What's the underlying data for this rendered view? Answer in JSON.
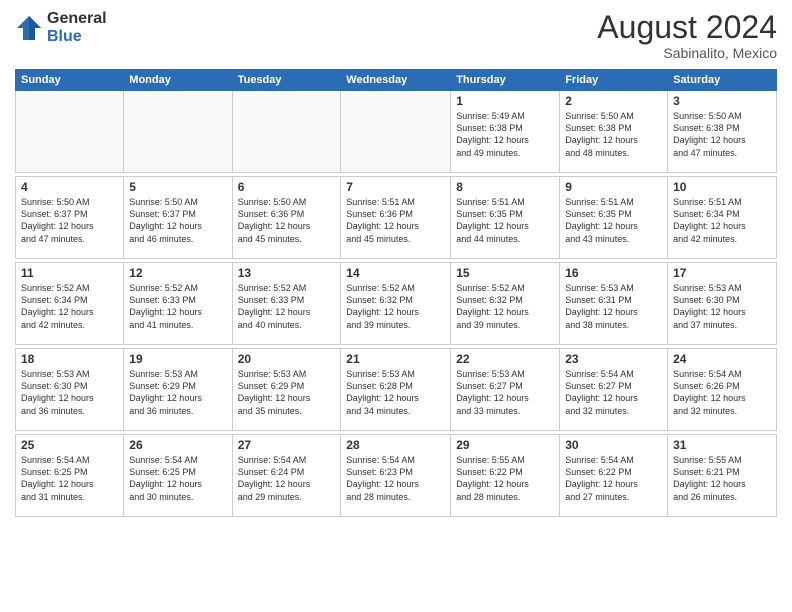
{
  "header": {
    "logo_general": "General",
    "logo_blue": "Blue",
    "main_title": "August 2024",
    "subtitle": "Sabinalito, Mexico"
  },
  "days_of_week": [
    "Sunday",
    "Monday",
    "Tuesday",
    "Wednesday",
    "Thursday",
    "Friday",
    "Saturday"
  ],
  "weeks": [
    {
      "cells": [
        {
          "empty": true
        },
        {
          "empty": true
        },
        {
          "empty": true
        },
        {
          "empty": true
        },
        {
          "day": 1,
          "sunrise": "5:49 AM",
          "sunset": "6:38 PM",
          "daylight_hours": "12 hours",
          "daylight_minutes": "49 minutes"
        },
        {
          "day": 2,
          "sunrise": "5:50 AM",
          "sunset": "6:38 PM",
          "daylight_hours": "12 hours",
          "daylight_minutes": "48 minutes"
        },
        {
          "day": 3,
          "sunrise": "5:50 AM",
          "sunset": "6:38 PM",
          "daylight_hours": "12 hours",
          "daylight_minutes": "47 minutes"
        }
      ]
    },
    {
      "cells": [
        {
          "day": 4,
          "sunrise": "5:50 AM",
          "sunset": "6:37 PM",
          "daylight_hours": "12 hours",
          "daylight_minutes": "47 minutes"
        },
        {
          "day": 5,
          "sunrise": "5:50 AM",
          "sunset": "6:37 PM",
          "daylight_hours": "12 hours",
          "daylight_minutes": "46 minutes"
        },
        {
          "day": 6,
          "sunrise": "5:50 AM",
          "sunset": "6:36 PM",
          "daylight_hours": "12 hours",
          "daylight_minutes": "45 minutes"
        },
        {
          "day": 7,
          "sunrise": "5:51 AM",
          "sunset": "6:36 PM",
          "daylight_hours": "12 hours",
          "daylight_minutes": "45 minutes"
        },
        {
          "day": 8,
          "sunrise": "5:51 AM",
          "sunset": "6:35 PM",
          "daylight_hours": "12 hours",
          "daylight_minutes": "44 minutes"
        },
        {
          "day": 9,
          "sunrise": "5:51 AM",
          "sunset": "6:35 PM",
          "daylight_hours": "12 hours",
          "daylight_minutes": "43 minutes"
        },
        {
          "day": 10,
          "sunrise": "5:51 AM",
          "sunset": "6:34 PM",
          "daylight_hours": "12 hours",
          "daylight_minutes": "42 minutes"
        }
      ]
    },
    {
      "cells": [
        {
          "day": 11,
          "sunrise": "5:52 AM",
          "sunset": "6:34 PM",
          "daylight_hours": "12 hours",
          "daylight_minutes": "42 minutes"
        },
        {
          "day": 12,
          "sunrise": "5:52 AM",
          "sunset": "6:33 PM",
          "daylight_hours": "12 hours",
          "daylight_minutes": "41 minutes"
        },
        {
          "day": 13,
          "sunrise": "5:52 AM",
          "sunset": "6:33 PM",
          "daylight_hours": "12 hours",
          "daylight_minutes": "40 minutes"
        },
        {
          "day": 14,
          "sunrise": "5:52 AM",
          "sunset": "6:32 PM",
          "daylight_hours": "12 hours",
          "daylight_minutes": "39 minutes"
        },
        {
          "day": 15,
          "sunrise": "5:52 AM",
          "sunset": "6:32 PM",
          "daylight_hours": "12 hours",
          "daylight_minutes": "39 minutes"
        },
        {
          "day": 16,
          "sunrise": "5:53 AM",
          "sunset": "6:31 PM",
          "daylight_hours": "12 hours",
          "daylight_minutes": "38 minutes"
        },
        {
          "day": 17,
          "sunrise": "5:53 AM",
          "sunset": "6:30 PM",
          "daylight_hours": "12 hours",
          "daylight_minutes": "37 minutes"
        }
      ]
    },
    {
      "cells": [
        {
          "day": 18,
          "sunrise": "5:53 AM",
          "sunset": "6:30 PM",
          "daylight_hours": "12 hours",
          "daylight_minutes": "36 minutes"
        },
        {
          "day": 19,
          "sunrise": "5:53 AM",
          "sunset": "6:29 PM",
          "daylight_hours": "12 hours",
          "daylight_minutes": "36 minutes"
        },
        {
          "day": 20,
          "sunrise": "5:53 AM",
          "sunset": "6:29 PM",
          "daylight_hours": "12 hours",
          "daylight_minutes": "35 minutes"
        },
        {
          "day": 21,
          "sunrise": "5:53 AM",
          "sunset": "6:28 PM",
          "daylight_hours": "12 hours",
          "daylight_minutes": "34 minutes"
        },
        {
          "day": 22,
          "sunrise": "5:53 AM",
          "sunset": "6:27 PM",
          "daylight_hours": "12 hours",
          "daylight_minutes": "33 minutes"
        },
        {
          "day": 23,
          "sunrise": "5:54 AM",
          "sunset": "6:27 PM",
          "daylight_hours": "12 hours",
          "daylight_minutes": "32 minutes"
        },
        {
          "day": 24,
          "sunrise": "5:54 AM",
          "sunset": "6:26 PM",
          "daylight_hours": "12 hours",
          "daylight_minutes": "32 minutes"
        }
      ]
    },
    {
      "cells": [
        {
          "day": 25,
          "sunrise": "5:54 AM",
          "sunset": "6:25 PM",
          "daylight_hours": "12 hours",
          "daylight_minutes": "31 minutes"
        },
        {
          "day": 26,
          "sunrise": "5:54 AM",
          "sunset": "6:25 PM",
          "daylight_hours": "12 hours",
          "daylight_minutes": "30 minutes"
        },
        {
          "day": 27,
          "sunrise": "5:54 AM",
          "sunset": "6:24 PM",
          "daylight_hours": "12 hours",
          "daylight_minutes": "29 minutes"
        },
        {
          "day": 28,
          "sunrise": "5:54 AM",
          "sunset": "6:23 PM",
          "daylight_hours": "12 hours",
          "daylight_minutes": "28 minutes"
        },
        {
          "day": 29,
          "sunrise": "5:55 AM",
          "sunset": "6:22 PM",
          "daylight_hours": "12 hours",
          "daylight_minutes": "28 minutes"
        },
        {
          "day": 30,
          "sunrise": "5:54 AM",
          "sunset": "6:22 PM",
          "daylight_hours": "12 hours",
          "daylight_minutes": "27 minutes"
        },
        {
          "day": 31,
          "sunrise": "5:55 AM",
          "sunset": "6:21 PM",
          "daylight_hours": "12 hours",
          "daylight_minutes": "26 minutes"
        }
      ]
    }
  ],
  "labels": {
    "sunrise": "Sunrise:",
    "sunset": "Sunset:",
    "daylight": "Daylight:"
  }
}
